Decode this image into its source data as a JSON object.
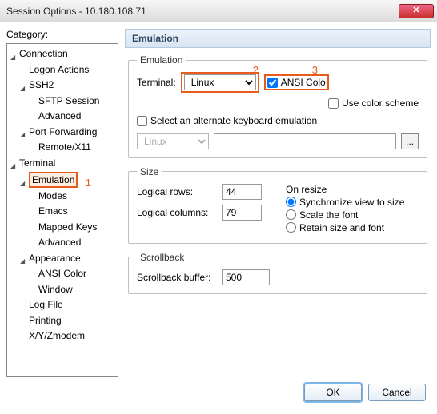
{
  "window": {
    "title": "Session Options - 10.180.108.71"
  },
  "category": {
    "label": "Category:",
    "tree": {
      "connection": "Connection",
      "logon_actions": "Logon Actions",
      "ssh2": "SSH2",
      "sftp_session": "SFTP Session",
      "advanced_ssh": "Advanced",
      "port_forwarding": "Port Forwarding",
      "remote_x11": "Remote/X11",
      "terminal": "Terminal",
      "emulation": "Emulation",
      "modes": "Modes",
      "emacs": "Emacs",
      "mapped_keys": "Mapped Keys",
      "advanced_term": "Advanced",
      "appearance": "Appearance",
      "ansi_color": "ANSI Color",
      "window": "Window",
      "log_file": "Log File",
      "printing": "Printing",
      "xyz": "X/Y/Zmodem"
    }
  },
  "panel": {
    "title": "Emulation",
    "emulation": {
      "legend": "Emulation",
      "terminal_label": "Terminal:",
      "terminal_value": "Linux",
      "ansi_color_label": "ANSI Colo",
      "use_color_scheme_label": "Use color scheme",
      "select_alt_label": "Select an alternate keyboard emulation",
      "alt_value": "Linux",
      "browse": "..."
    },
    "size": {
      "legend": "Size",
      "rows_label": "Logical rows:",
      "rows_value": "44",
      "cols_label": "Logical columns:",
      "cols_value": "79",
      "on_resize_label": "On resize",
      "sync": "Synchronize view to size",
      "scale": "Scale the font",
      "retain": "Retain size and font"
    },
    "scrollback": {
      "legend": "Scrollback",
      "buffer_label": "Scrollback buffer:",
      "buffer_value": "500"
    }
  },
  "annotations": {
    "one": "1",
    "two": "2",
    "three": "3"
  },
  "footer": {
    "ok": "OK",
    "cancel": "Cancel"
  }
}
